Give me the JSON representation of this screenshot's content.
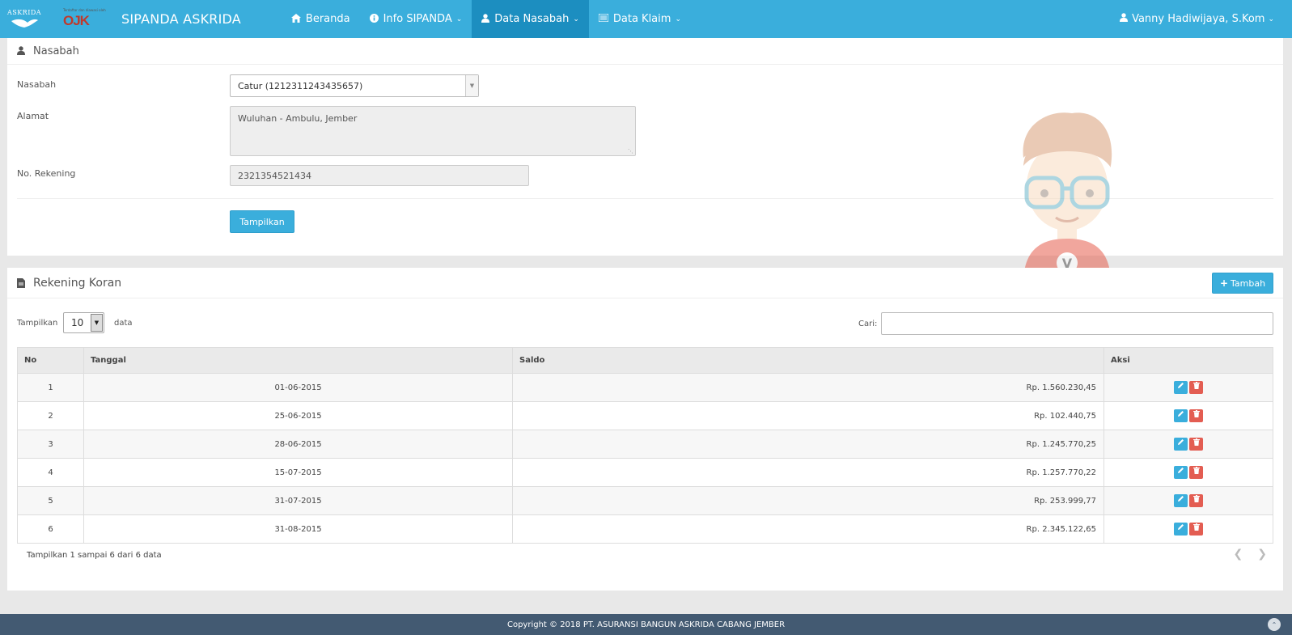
{
  "navbar": {
    "brand_logo_text": "ASKRIDA",
    "ojk_logo_text": "OJK",
    "ojk_logo_small": "Terdaftar dan diawasi oleh",
    "title": "SIPANDA ASKRIDA",
    "items": [
      {
        "label": "Beranda",
        "icon": "home-icon"
      },
      {
        "label": "Info SIPANDA",
        "icon": "info-icon"
      },
      {
        "label": "Data Nasabah",
        "icon": "user-icon"
      },
      {
        "label": "Data Klaim",
        "icon": "list-icon"
      }
    ],
    "user": "Vanny Hadiwijaya, S.Kom"
  },
  "nasabah_panel": {
    "title": "Nasabah",
    "fields": {
      "nasabah_label": "Nasabah",
      "nasabah_value": "Catur (1212311243435657)",
      "alamat_label": "Alamat",
      "alamat_value": "Wuluhan - Ambulu, Jember",
      "rekening_label": "No. Rekening",
      "rekening_value": "2321354521434"
    },
    "show_button": "Tampilkan",
    "avatar_letter": "V"
  },
  "koran_panel": {
    "title": "Rekening Koran",
    "add_button": "Tambah",
    "length_label": "Tampilkan",
    "length_value": "10",
    "length_suffix": "data",
    "search_label": "Cari:",
    "columns": [
      "No",
      "Tanggal",
      "Saldo",
      "Aksi"
    ],
    "rows": [
      {
        "no": "1",
        "tanggal": "01-06-2015",
        "saldo": "Rp. 1.560.230,45"
      },
      {
        "no": "2",
        "tanggal": "25-06-2015",
        "saldo": "Rp. 102.440,75"
      },
      {
        "no": "3",
        "tanggal": "28-06-2015",
        "saldo": "Rp. 1.245.770,25"
      },
      {
        "no": "4",
        "tanggal": "15-07-2015",
        "saldo": "Rp. 1.257.770,22"
      },
      {
        "no": "5",
        "tanggal": "31-07-2015",
        "saldo": "Rp. 253.999,77"
      },
      {
        "no": "6",
        "tanggal": "31-08-2015",
        "saldo": "Rp. 2.345.122,65"
      }
    ],
    "info": "Tampilkan 1 sampai 6 dari 6 data"
  },
  "footer": {
    "copyright": "Copyright © 2018 PT. ASURANSI BANGUN ASKRIDA CABANG JEMBER"
  },
  "colors": {
    "primary": "#3aaedc",
    "nav_active": "#1c8ec0",
    "danger": "#e35d52",
    "footer": "#435a72"
  }
}
